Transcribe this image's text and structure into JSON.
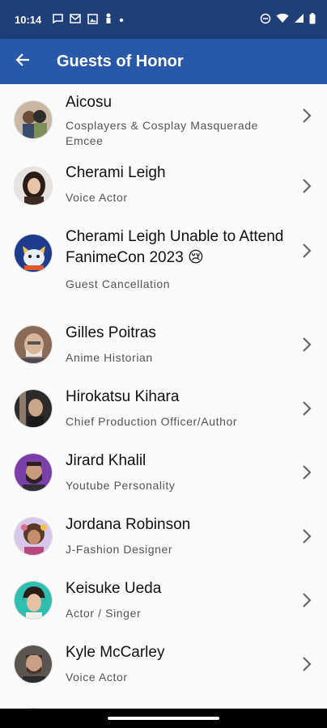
{
  "status_bar": {
    "time": "10:14",
    "left_icons": [
      "message-icon",
      "mail-icon",
      "image-icon",
      "bolt-icon",
      "dot-icon"
    ],
    "right_icons": [
      "dnd-icon",
      "wifi-icon",
      "signal-icon",
      "battery-icon"
    ]
  },
  "app_bar": {
    "title": "Guests of Honor",
    "back_icon": "arrow-left-icon",
    "color": "#2858a8"
  },
  "status_color": "#1e3f78",
  "guests": [
    {
      "name": "Aicosu",
      "role": "Cosplayers & Cosplay Masquerade Emcee"
    },
    {
      "name": "Cherami Leigh",
      "role": "Voice Actor"
    },
    {
      "name": "Cherami Leigh Unable to Attend FanimeCon 2023 😢",
      "role": "Guest Cancellation"
    },
    {
      "name": "Gilles Poitras",
      "role": "Anime Historian"
    },
    {
      "name": "Hirokatsu Kihara",
      "role": "Chief Production Officer/Author"
    },
    {
      "name": "Jirard Khalil",
      "role": "Youtube Personality"
    },
    {
      "name": "Jordana Robinson",
      "role": "J-Fashion Designer"
    },
    {
      "name": "Keisuke Ueda",
      "role": "Actor / Singer"
    },
    {
      "name": "Kyle McCarley",
      "role": "Voice Actor"
    }
  ]
}
